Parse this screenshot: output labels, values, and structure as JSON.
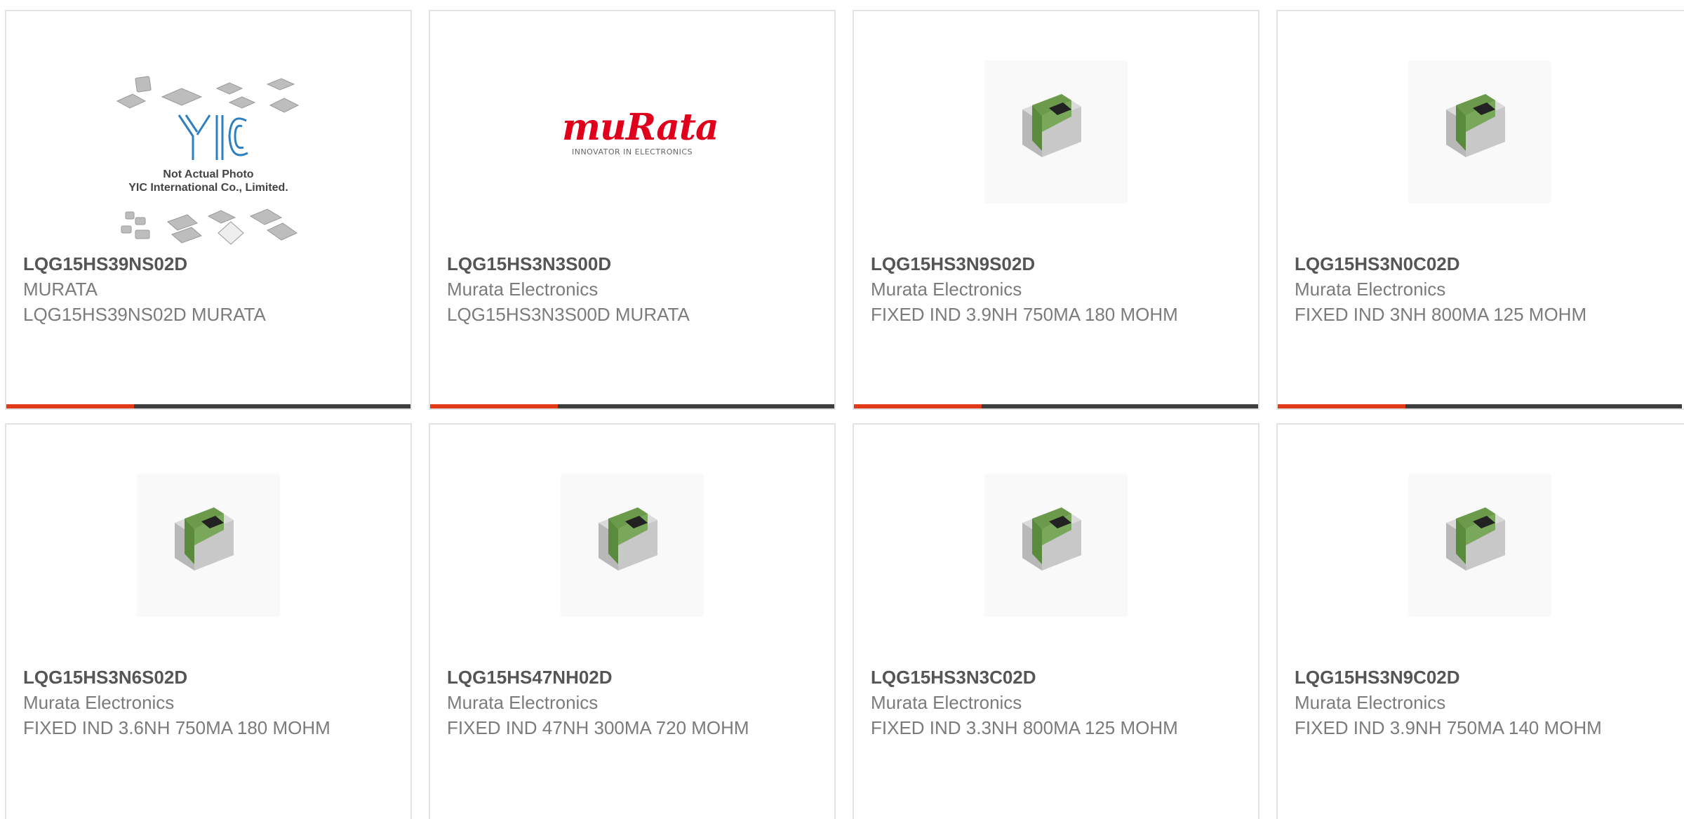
{
  "products": [
    {
      "part": "LQG15HS39NS02D",
      "maker": "MURATA",
      "desc": "LQG15HS39NS02D MURATA",
      "image": "placeholder-photo",
      "placeholder": {
        "logo": "YIC",
        "line1": "Not Actual Photo",
        "line2": "YIC International Co., Limited."
      }
    },
    {
      "part": "LQG15HS3N3S00D",
      "maker": "Murata Electronics",
      "desc": "LQG15HS3N3S00D MURATA",
      "image": "murata-logo",
      "logo": {
        "word": "muRata",
        "tagline": "INNOVATOR IN ELECTRONICS"
      }
    },
    {
      "part": "LQG15HS3N9S02D",
      "maker": "Murata Electronics",
      "desc": "FIXED IND 3.9NH 750MA 180 MOHM",
      "image": "chip-inductor"
    },
    {
      "part": "LQG15HS3N0C02D",
      "maker": "Murata Electronics",
      "desc": "FIXED IND 3NH 800MA 125 MOHM",
      "image": "chip-inductor"
    },
    {
      "part": "LQG15HS3N6S02D",
      "maker": "Murata Electronics",
      "desc": "FIXED IND 3.6NH 750MA 180 MOHM",
      "image": "chip-inductor"
    },
    {
      "part": "LQG15HS47NH02D",
      "maker": "Murata Electronics",
      "desc": "FIXED IND 47NH 300MA 720 MOHM",
      "image": "chip-inductor"
    },
    {
      "part": "LQG15HS3N3C02D",
      "maker": "Murata Electronics",
      "desc": "FIXED IND 3.3NH 800MA 125 MOHM",
      "image": "chip-inductor"
    },
    {
      "part": "LQG15HS3N9C02D",
      "maker": "Murata Electronics",
      "desc": "FIXED IND 3.9NH 750MA 140 MOHM",
      "image": "chip-inductor"
    }
  ],
  "colors": {
    "accent": "#e03a18",
    "bar_dark": "#3e3e3e",
    "chip_green": "#6a9a4a"
  }
}
